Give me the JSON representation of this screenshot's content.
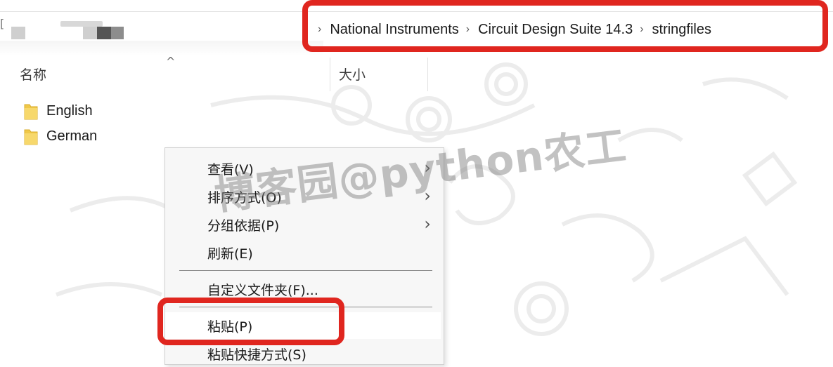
{
  "address_bar": {
    "breadcrumb": [
      {
        "label": "National Instruments"
      },
      {
        "label": "Circuit Design Suite 14.3"
      },
      {
        "label": "stringfiles"
      }
    ]
  },
  "columns": [
    {
      "label": "名称"
    },
    {
      "label": "大小"
    }
  ],
  "files": [
    {
      "name": "English",
      "icon": "folder-icon"
    },
    {
      "name": "German",
      "icon": "folder-icon"
    }
  ],
  "context_menu": {
    "items": [
      {
        "label": "查看(V)",
        "has_submenu": true
      },
      {
        "label": "排序方式(O)",
        "has_submenu": true
      },
      {
        "label": "分组依据(P)",
        "has_submenu": true
      },
      {
        "label": "刷新(E)",
        "has_submenu": false
      },
      {
        "label": "自定义文件夹(F)...",
        "has_submenu": false
      },
      {
        "label": "粘贴(P)",
        "has_submenu": false,
        "highlighted": true
      },
      {
        "label": "粘贴快捷方式(S)",
        "has_submenu": false
      }
    ]
  },
  "watermark": {
    "text": "博客园@python农工"
  },
  "colors": {
    "highlight_box": "#e0261f",
    "folder": "#f0c848",
    "menu_background": "#f7f7f7"
  }
}
